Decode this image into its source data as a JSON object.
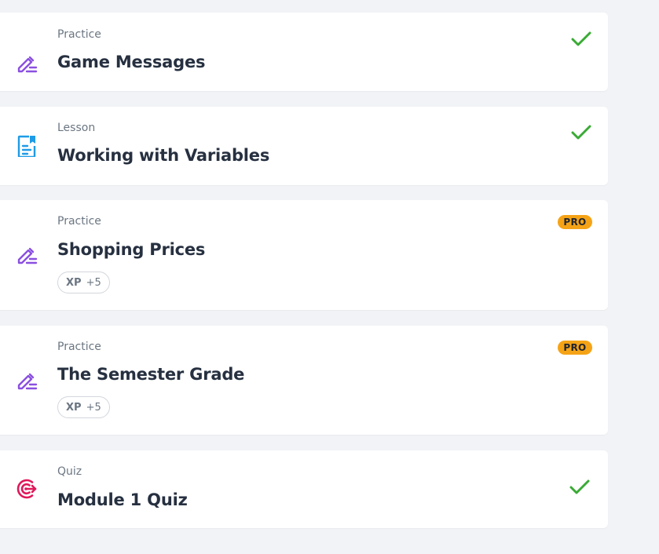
{
  "colors": {
    "page_background": "#f1f3f6",
    "card_background": "#ffffff",
    "practice_icon": "#8a4fe0",
    "lesson_icon": "#1e9be6",
    "quiz_icon": "#e0185a",
    "check": "#3aaa35",
    "pro_badge": "#f5a316",
    "title_text": "#263040",
    "type_text": "#6b7682"
  },
  "items": [
    {
      "type": "Practice",
      "title": "Game Messages",
      "icon": "pencil-edit-icon",
      "status": "completed"
    },
    {
      "type": "Lesson",
      "title": "Working with Variables",
      "icon": "document-bookmark-icon",
      "status": "completed"
    },
    {
      "type": "Practice",
      "title": "Shopping Prices",
      "icon": "pencil-edit-icon",
      "status": "locked-pro",
      "badge": "PRO",
      "xp_label": "XP",
      "xp_value": "+5"
    },
    {
      "type": "Practice",
      "title": "The Semester Grade",
      "icon": "pencil-edit-icon",
      "status": "locked-pro",
      "badge": "PRO",
      "xp_label": "XP",
      "xp_value": "+5"
    },
    {
      "type": "Quiz",
      "title": "Module 1 Quiz",
      "icon": "target-icon",
      "status": "completed"
    }
  ]
}
